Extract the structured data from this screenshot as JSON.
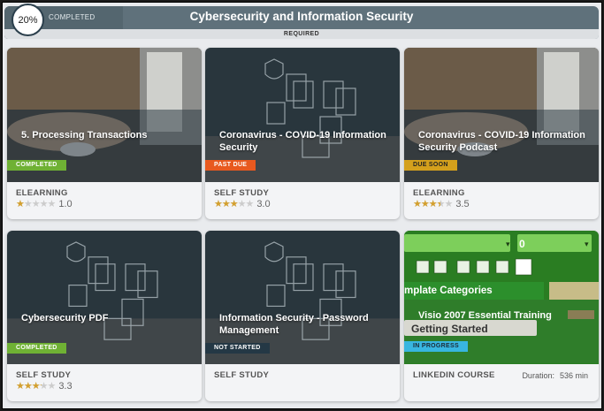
{
  "header": {
    "progress_percent": "20%",
    "progress_value": 20,
    "completed_label": "COMPLETED",
    "title": "Cybersecurity and Information Security",
    "required_label": "REQUIRED"
  },
  "cards": [
    {
      "title": "5. Processing Transactions",
      "badge": "COMPLETED",
      "type": "ELEARNING",
      "rating": "1.0",
      "rating_value": 1.0
    },
    {
      "title": "Coronavirus - COVID-19 Information Security",
      "badge": "PAST DUE",
      "type": "SELF STUDY",
      "rating": "3.0",
      "rating_value": 3.0
    },
    {
      "title": "Coronavirus - COVID-19 Information Security Podcast",
      "badge": "DUE SOON",
      "type": "ELEARNING",
      "rating": "3.5",
      "rating_value": 3.5
    },
    {
      "title": "Cybersecurity PDF",
      "badge": "COMPLETED",
      "type": "SELF STUDY",
      "rating": "3.3",
      "rating_value": 3.3
    },
    {
      "title": "Information Security - Password Management",
      "badge": "NOT STARTED",
      "type": "SELF STUDY"
    },
    {
      "title": "",
      "badge": "IN PROGRESS",
      "type": "LINKEDIN COURSE",
      "duration_label": "Duration:",
      "duration_value": "536 min",
      "thumb_dropdown_value": "0",
      "thumb_heading": "mplate Categories",
      "thumb_item": "Visio 2007 Essential Training",
      "thumb_getting_started": "Getting Started"
    }
  ],
  "colors": {
    "header_bg": "#5f717b",
    "completed": "#6fb134",
    "past_due": "#e8591f",
    "due_soon": "#d4a01c",
    "not_started": "#243845",
    "in_progress": "#38b6e0",
    "star": "#d4a02e"
  }
}
